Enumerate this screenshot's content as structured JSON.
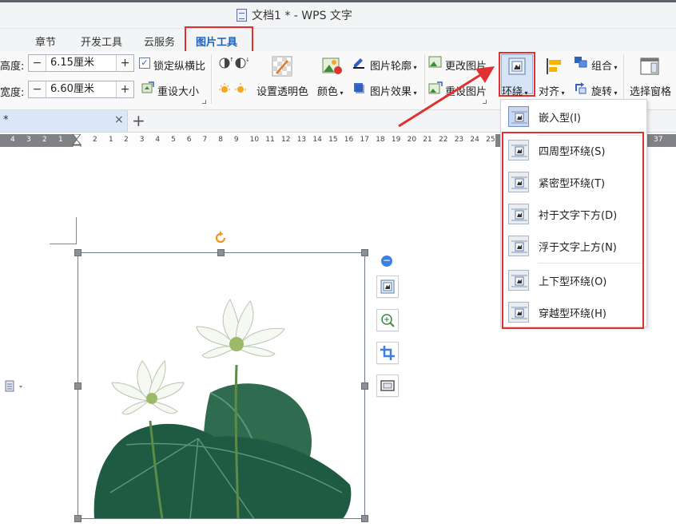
{
  "window": {
    "title": "文档1 * - WPS 文字"
  },
  "ribbon_tabs": [
    {
      "label": "章节"
    },
    {
      "label": "开发工具"
    },
    {
      "label": "云服务"
    },
    {
      "label": "图片工具",
      "active": true
    }
  ],
  "size": {
    "height_label": "高度:",
    "height_value": "6.15厘米",
    "width_label": "宽度:",
    "width_value": "6.60厘米",
    "lock_ratio_label": "锁定纵横比",
    "reset_size_label": "重设大小"
  },
  "tools": {
    "transparent_label": "设置透明色",
    "color_label": "颜色",
    "outline_label": "图片轮廓",
    "effect_label": "图片效果",
    "change_label": "更改图片",
    "reset_label": "重设图片",
    "wrap_label": "环绕",
    "align_label": "对齐",
    "group_label": "组合",
    "rotate_label": "旋转",
    "selection_pane_label": "选择窗格"
  },
  "doc_tab": {
    "name": "*",
    "close": "×",
    "new": "+"
  },
  "ruler": {
    "left": [
      "4",
      "3",
      "2",
      "1",
      "2",
      "1"
    ],
    "right": [
      "2",
      "3",
      "4",
      "5",
      "6",
      "7",
      "8",
      "9",
      "10",
      "11",
      "12",
      "13",
      "14",
      "15",
      "16",
      "17",
      "18",
      "19",
      "20",
      "21",
      "22",
      "23",
      "24",
      "25",
      "26"
    ],
    "end": "37"
  },
  "wrap_menu": {
    "items": [
      {
        "label": "嵌入型(I)"
      },
      {
        "label": "四周型环绕(S)"
      },
      {
        "label": "紧密型环绕(T)"
      },
      {
        "label": "衬于文字下方(D)"
      },
      {
        "label": "浮于文字上方(N)"
      },
      {
        "label": "上下型环绕(O)"
      },
      {
        "label": "穿越型环绕(H)"
      }
    ]
  },
  "colors": {
    "highlight_red": "#e03030",
    "accent_blue": "#1f5fb8"
  }
}
